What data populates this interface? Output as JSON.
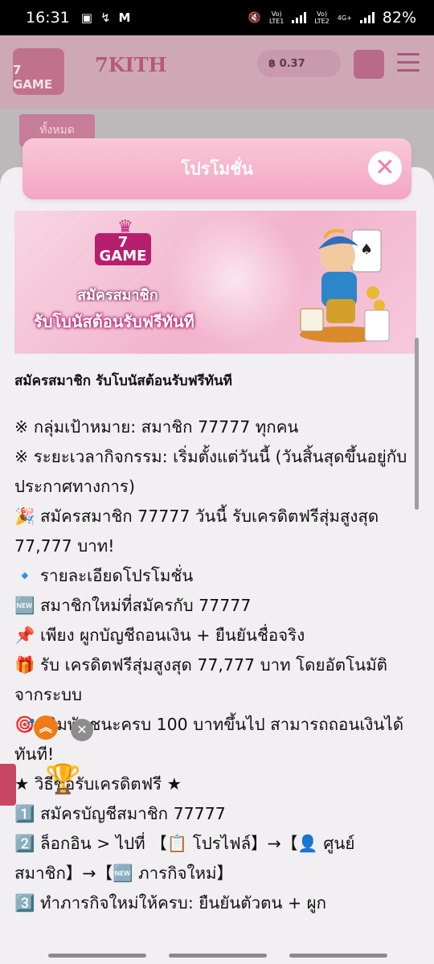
{
  "status": {
    "time": "16:31",
    "battery": "82%",
    "sim1": "LTE1",
    "sim2": "LTE2",
    "net": "4G+"
  },
  "site": {
    "brand": "7KITH",
    "logo_text": "7 GAME",
    "balance": "฿ 0.37",
    "tab_label": "ทั้งหมด"
  },
  "modal": {
    "title": "โปรโมชั่น",
    "close_icon": "close-icon",
    "banner": {
      "logo_line1": "7",
      "logo_line2": "GAME",
      "line1": "สมัครสมาชิก",
      "line2": "รับโบนัสต้อนรับฟรีทันที"
    },
    "headline": "สมัครสมาชิก รับโบนัสต้อนรับฟรีทันที",
    "lines": [
      "※  กลุ่มเป้าหมาย: สมาชิก 77777 ทุกคน",
      "※  ระยะเวลากิจกรรม: เริ่มตั้งแต่วันนี้ (วันสิ้นสุดขึ้นอยู่กับประกาศทางการ)",
      "🎉 สมัครสมาชิก 77777 วันนี้ รับเครดิตฟรีสุ่มสูงสุด 77,777 บาท!",
      "🔹 รายละเอียดโปรโมชั่น",
      "🆕 สมาชิกใหม่ที่สมัครกับ 77777",
      "📌 เพียง ผูกบัญชีถอนเงิน + ยืนยันชื่อจริง",
      "🎁 รับ เครดิตฟรีสุ่มสูงสุด 77,777 บาท โดยอัตโนมัติจากระบบ",
      "🎯 เติมพันชนะครบ 100 บาทขึ้นไป สามารถถอนเงินได้ทันที!",
      "★ วิธีขอรับเครดิตฟรี ★",
      "1️⃣ สมัครบัญชีสมาชิก 77777",
      "2️⃣ ล็อกอิน > ไปที่ 【📋 โปรไฟล์】→【👤 ศูนย์สมาชิก】→【🆕 ภารกิจใหม่】",
      "3️⃣ ทำภารกิจใหม่ให้ครบ: ยืนยันตัวตน + ผูก"
    ]
  }
}
